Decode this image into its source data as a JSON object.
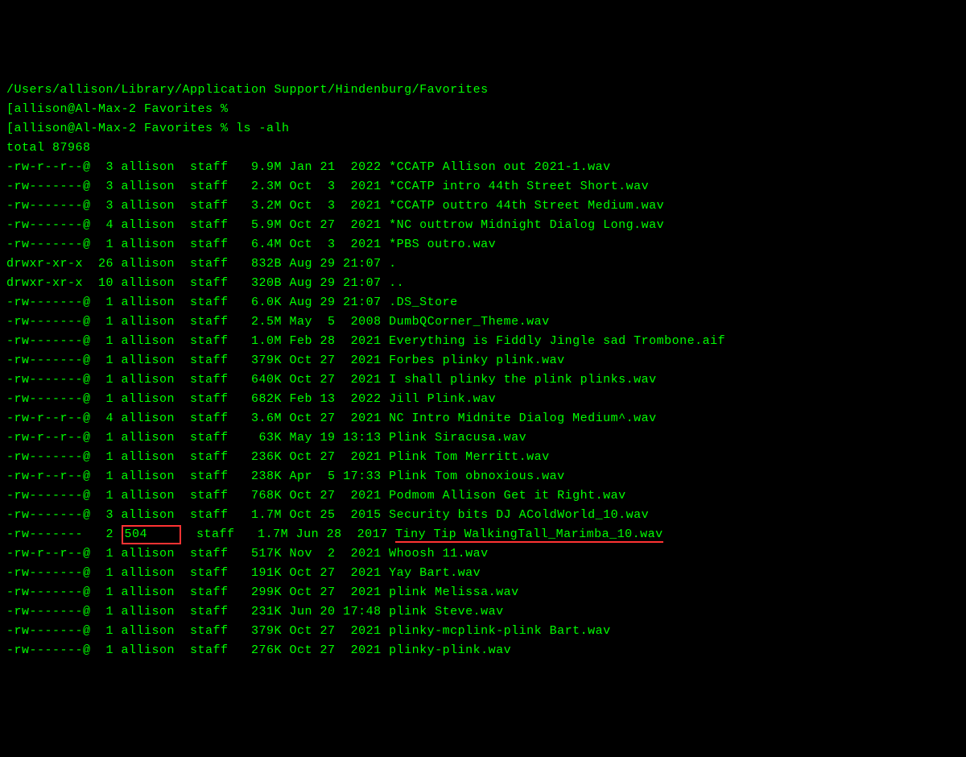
{
  "path_line": "/Users/allison/Library/Application Support/Hindenburg/Favorites",
  "prompt1": "[allison@Al-Max-2 Favorites %",
  "prompt2_prefix": "[allison@Al-Max-2 Favorites % ",
  "command": "ls -alh",
  "total": "total 87968",
  "rows": [
    {
      "perm": "-rw-r--r--@",
      "links": " 3",
      "owner": "allison",
      "group": "staff",
      "size": "9.9M",
      "month": "Jan",
      "day": "21",
      "time": " 2022",
      "name": "*CCATP Allison out 2021-1.wav"
    },
    {
      "perm": "-rw-------@",
      "links": " 3",
      "owner": "allison",
      "group": "staff",
      "size": "2.3M",
      "month": "Oct",
      "day": " 3",
      "time": " 2021",
      "name": "*CCATP intro 44th Street Short.wav"
    },
    {
      "perm": "-rw-------@",
      "links": " 3",
      "owner": "allison",
      "group": "staff",
      "size": "3.2M",
      "month": "Oct",
      "day": " 3",
      "time": " 2021",
      "name": "*CCATP outtro 44th Street Medium.wav"
    },
    {
      "perm": "-rw-------@",
      "links": " 4",
      "owner": "allison",
      "group": "staff",
      "size": "5.9M",
      "month": "Oct",
      "day": "27",
      "time": " 2021",
      "name": "*NC outtrow Midnight Dialog Long.wav"
    },
    {
      "perm": "-rw-------@",
      "links": " 1",
      "owner": "allison",
      "group": "staff",
      "size": "6.4M",
      "month": "Oct",
      "day": " 3",
      "time": " 2021",
      "name": "*PBS outro.wav"
    },
    {
      "perm": "drwxr-xr-x ",
      "links": "26",
      "owner": "allison",
      "group": "staff",
      "size": "832B",
      "month": "Aug",
      "day": "29",
      "time": "21:07",
      "name": "."
    },
    {
      "perm": "drwxr-xr-x ",
      "links": "10",
      "owner": "allison",
      "group": "staff",
      "size": "320B",
      "month": "Aug",
      "day": "29",
      "time": "21:07",
      "name": ".."
    },
    {
      "perm": "-rw-------@",
      "links": " 1",
      "owner": "allison",
      "group": "staff",
      "size": "6.0K",
      "month": "Aug",
      "day": "29",
      "time": "21:07",
      "name": ".DS_Store"
    },
    {
      "perm": "-rw-------@",
      "links": " 1",
      "owner": "allison",
      "group": "staff",
      "size": "2.5M",
      "month": "May",
      "day": " 5",
      "time": " 2008",
      "name": "DumbQCorner_Theme.wav"
    },
    {
      "perm": "-rw-------@",
      "links": " 1",
      "owner": "allison",
      "group": "staff",
      "size": "1.0M",
      "month": "Feb",
      "day": "28",
      "time": " 2021",
      "name": "Everything is Fiddly Jingle sad Trombone.aif"
    },
    {
      "perm": "-rw-------@",
      "links": " 1",
      "owner": "allison",
      "group": "staff",
      "size": "379K",
      "month": "Oct",
      "day": "27",
      "time": " 2021",
      "name": "Forbes plinky plink.wav"
    },
    {
      "perm": "-rw-------@",
      "links": " 1",
      "owner": "allison",
      "group": "staff",
      "size": "640K",
      "month": "Oct",
      "day": "27",
      "time": " 2021",
      "name": "I shall plinky the plink plinks.wav"
    },
    {
      "perm": "-rw-------@",
      "links": " 1",
      "owner": "allison",
      "group": "staff",
      "size": "682K",
      "month": "Feb",
      "day": "13",
      "time": " 2022",
      "name": "Jill Plink.wav"
    },
    {
      "perm": "-rw-r--r--@",
      "links": " 4",
      "owner": "allison",
      "group": "staff",
      "size": "3.6M",
      "month": "Oct",
      "day": "27",
      "time": " 2021",
      "name": "NC Intro Midnite Dialog Medium^.wav"
    },
    {
      "perm": "-rw-r--r--@",
      "links": " 1",
      "owner": "allison",
      "group": "staff",
      "size": " 63K",
      "month": "May",
      "day": "19",
      "time": "13:13",
      "name": "Plink Siracusa.wav"
    },
    {
      "perm": "-rw-------@",
      "links": " 1",
      "owner": "allison",
      "group": "staff",
      "size": "236K",
      "month": "Oct",
      "day": "27",
      "time": " 2021",
      "name": "Plink Tom Merritt.wav"
    },
    {
      "perm": "-rw-r--r--@",
      "links": " 1",
      "owner": "allison",
      "group": "staff",
      "size": "238K",
      "month": "Apr",
      "day": " 5",
      "time": "17:33",
      "name": "Plink Tom obnoxious.wav"
    },
    {
      "perm": "-rw-------@",
      "links": " 1",
      "owner": "allison",
      "group": "staff",
      "size": "768K",
      "month": "Oct",
      "day": "27",
      "time": " 2021",
      "name": "Podmom Allison Get it Right.wav"
    },
    {
      "perm": "-rw-------@",
      "links": " 3",
      "owner": "allison",
      "group": "staff",
      "size": "1.7M",
      "month": "Oct",
      "day": "25",
      "time": " 2015",
      "name": "Security bits DJ AColdWorld_10.wav"
    },
    {
      "perm": "-rw------- ",
      "links": " 2",
      "owner": "504    ",
      "group": "staff",
      "size": "1.7M",
      "month": "Jun",
      "day": "28",
      "time": " 2017",
      "name": "Tiny Tip WalkingTall_Marimba_10.wav",
      "highlight": true
    },
    {
      "perm": "-rw-r--r--@",
      "links": " 1",
      "owner": "allison",
      "group": "staff",
      "size": "517K",
      "month": "Nov",
      "day": " 2",
      "time": " 2021",
      "name": "Whoosh 11.wav"
    },
    {
      "perm": "-rw-------@",
      "links": " 1",
      "owner": "allison",
      "group": "staff",
      "size": "191K",
      "month": "Oct",
      "day": "27",
      "time": " 2021",
      "name": "Yay Bart.wav"
    },
    {
      "perm": "-rw-------@",
      "links": " 1",
      "owner": "allison",
      "group": "staff",
      "size": "299K",
      "month": "Oct",
      "day": "27",
      "time": " 2021",
      "name": "plink Melissa.wav"
    },
    {
      "perm": "-rw-------@",
      "links": " 1",
      "owner": "allison",
      "group": "staff",
      "size": "231K",
      "month": "Jun",
      "day": "20",
      "time": "17:48",
      "name": "plink Steve.wav"
    },
    {
      "perm": "-rw-------@",
      "links": " 1",
      "owner": "allison",
      "group": "staff",
      "size": "379K",
      "month": "Oct",
      "day": "27",
      "time": " 2021",
      "name": "plinky-mcplink-plink Bart.wav"
    },
    {
      "perm": "-rw-------@",
      "links": " 1",
      "owner": "allison",
      "group": "staff",
      "size": "276K",
      "month": "Oct",
      "day": "27",
      "time": " 2021",
      "name": "plinky-plink.wav"
    }
  ]
}
